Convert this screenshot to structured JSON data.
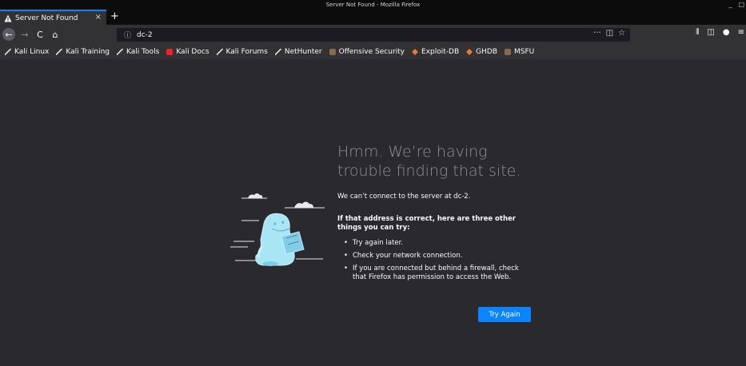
{
  "window": {
    "title": "Server Not Found - Mozilla Firefox"
  },
  "tab": {
    "title": "Server Not Found",
    "close": "×",
    "new_tab": "+"
  },
  "navbar": {
    "back": "←",
    "forward": "→",
    "reload": "C",
    "home": "⌂",
    "info": "ⓘ",
    "url": "dc-2",
    "page_actions": "···",
    "pocket": "◫",
    "bookmark_star": "☆"
  },
  "bookmarks": [
    {
      "label": "Kali Linux",
      "icon": "kali-dragon-icon"
    },
    {
      "label": "Kali Training",
      "icon": "kali-dragon-icon"
    },
    {
      "label": "Kali Tools",
      "icon": "kali-dragon-icon"
    },
    {
      "label": "Kali Docs",
      "icon": "kali-docs-icon"
    },
    {
      "label": "Kali Forums",
      "icon": "kali-dragon-icon"
    },
    {
      "label": "NetHunter",
      "icon": "nethunter-icon"
    },
    {
      "label": "Offensive Security",
      "icon": "offsec-icon"
    },
    {
      "label": "Exploit-DB",
      "icon": "exploitdb-icon"
    },
    {
      "label": "GHDB",
      "icon": "exploitdb-icon"
    },
    {
      "label": "MSFU",
      "icon": "offsec-icon"
    }
  ],
  "error": {
    "title": "Hmm. We’re having trouble finding that site.",
    "description": "We can’t connect to the server at dc-2.",
    "subtitle": "If that address is correct, here are three other things you can try:",
    "items": [
      "Try again later.",
      "Check your network connection.",
      "If you are connected but behind a firewall, check that Firefox has permission to access the Web."
    ],
    "button": "Try Again"
  },
  "colors": {
    "accent": "#0a84ff",
    "background": "#2a2a2e",
    "toolbar": "#323234"
  }
}
